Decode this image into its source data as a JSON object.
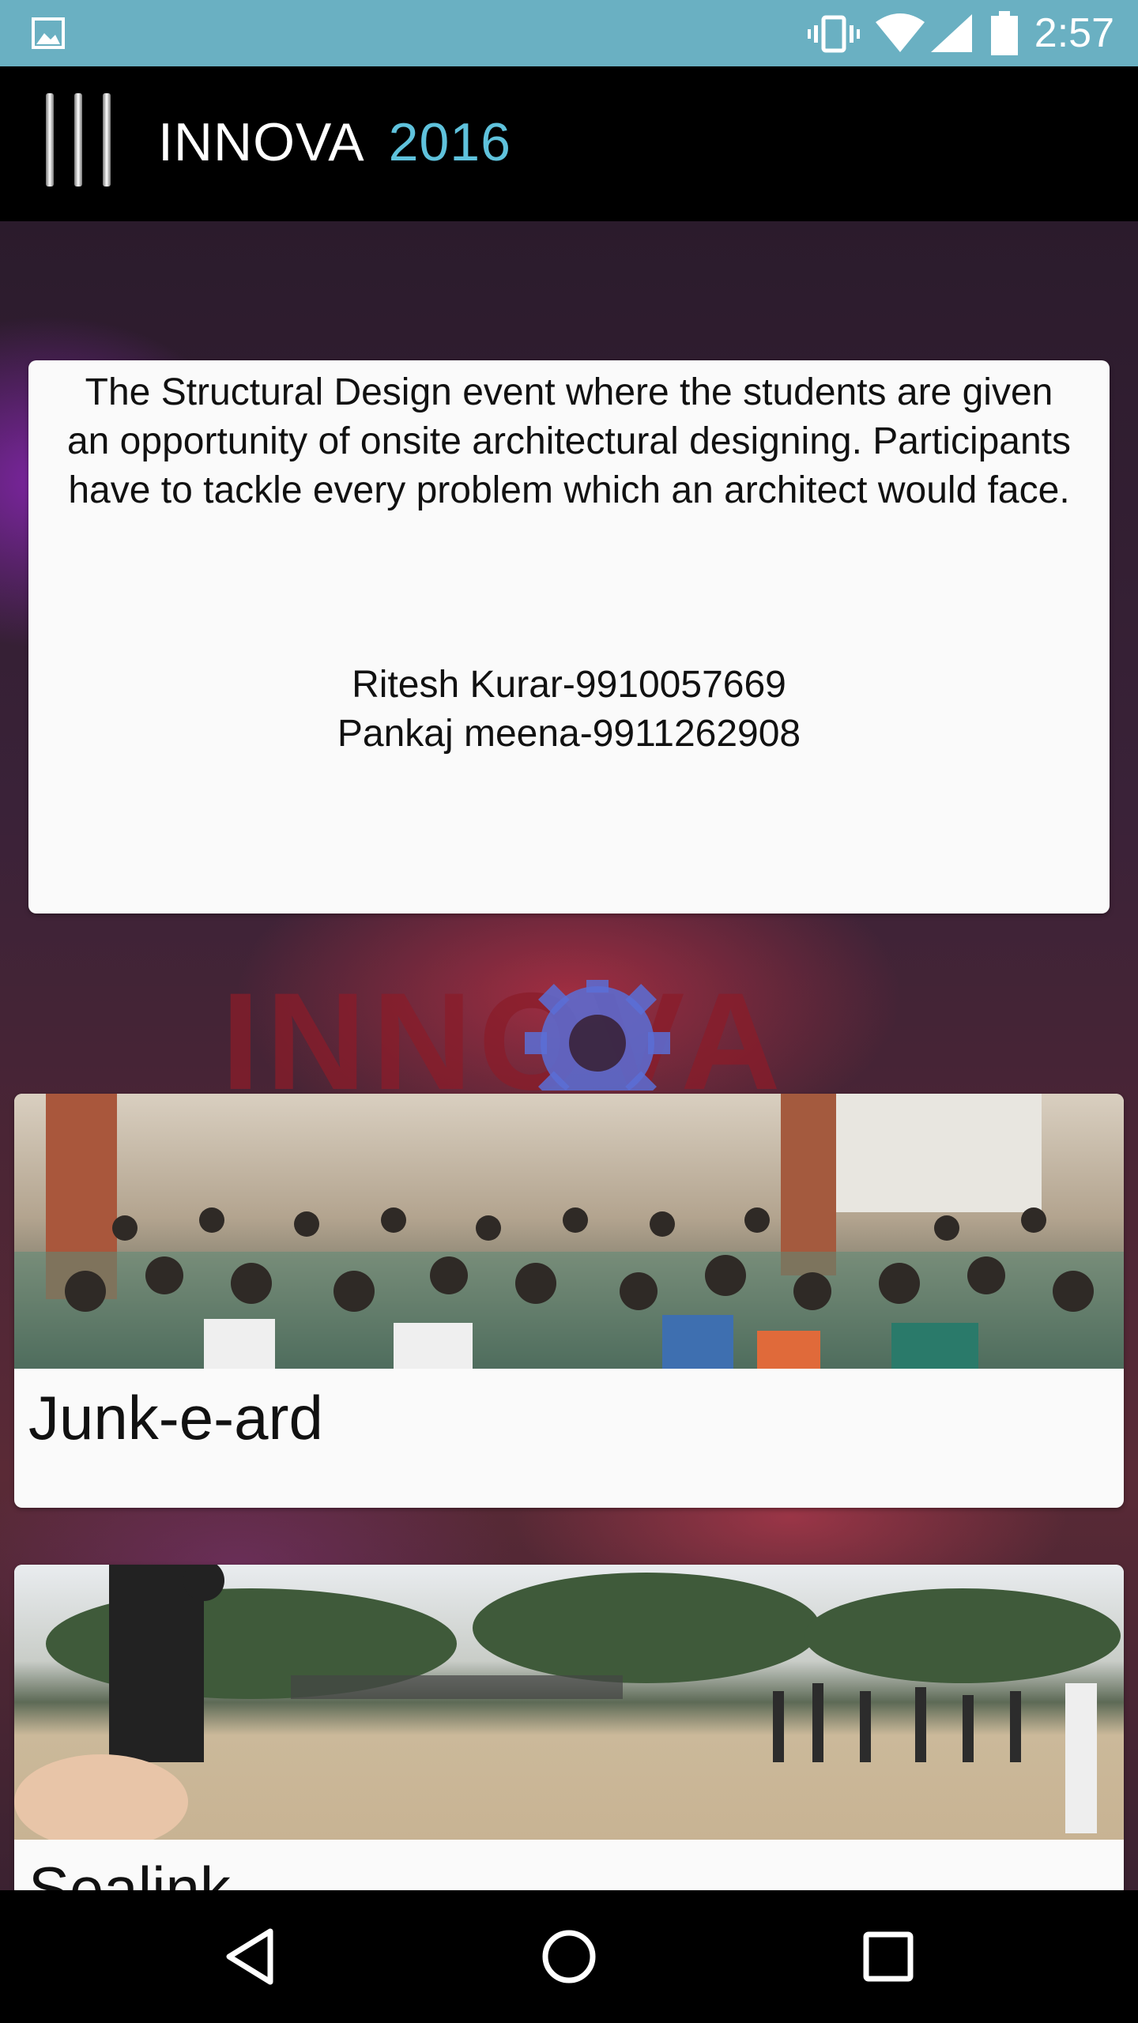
{
  "status_bar": {
    "time": "2:57",
    "icons": [
      "gallery-icon",
      "vibrate-icon",
      "wifi-icon",
      "signal-icon",
      "battery-icon"
    ]
  },
  "app_bar": {
    "title": "INNOVA",
    "year": "2016",
    "menu_icon": "menu-icon",
    "accent_color": "#5fc2dc"
  },
  "description_card": {
    "text": "The Structural Design event where the students are given an opportunity of onsite architectural designing. Participants have to tackle every problem which an architect would face.",
    "contacts": [
      "Ritesh Kurar-9910057669",
      "Pankaj meena-9911262908"
    ]
  },
  "background_logo": {
    "text": "INNOVA"
  },
  "events": [
    {
      "name": "Junk-e-ard",
      "image": "audience-photo"
    },
    {
      "name": "Sealink",
      "image": "outdoor-ground-photo"
    }
  ],
  "nav_bar": {
    "buttons": [
      "back-icon",
      "home-icon",
      "recents-icon"
    ]
  },
  "colors": {
    "status_bar": "#6ab0c2",
    "app_bar": "#000000",
    "card": "#fafafa"
  }
}
